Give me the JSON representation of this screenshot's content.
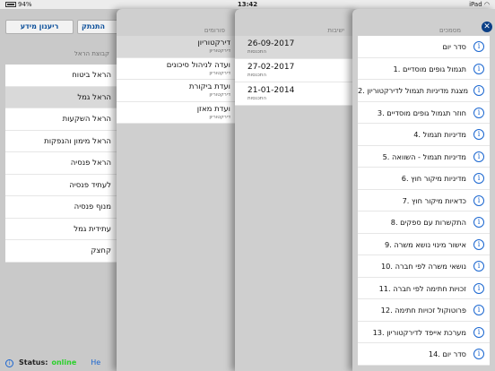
{
  "status_bar": {
    "battery": "94%",
    "time": "13:42",
    "device": "iPad"
  },
  "toolbar": {
    "info_button": "ריענון מידע",
    "logout_button": "התנתק"
  },
  "groups": {
    "header": "קבוצת הראל",
    "items": [
      {
        "label": "הראל ביטוח"
      },
      {
        "label": "הראל גמל"
      },
      {
        "label": "הראל השקעות"
      },
      {
        "label": "הראל מימון והנפקות"
      },
      {
        "label": "הראל פנסיה"
      },
      {
        "label": "לעתיד פנסיה"
      },
      {
        "label": "מנוף פנסיה"
      },
      {
        "label": "עתידית גמל"
      },
      {
        "label": "קחצק"
      }
    ]
  },
  "footer": {
    "status_label": "Status:",
    "status_value": "online",
    "lang": "He"
  },
  "forums": {
    "header": "פורומים",
    "items": [
      {
        "title": "דירקטוריון",
        "sub": "דירקטוריון"
      },
      {
        "title": "ועדה לניהול סיכונים",
        "sub": "דירקטוריון"
      },
      {
        "title": "ועדת ביקורת",
        "sub": "דירקטוריון"
      },
      {
        "title": "ועדת מאזן",
        "sub": "דירקטוריון"
      }
    ]
  },
  "meetings": {
    "header": "ישיבות",
    "items": [
      {
        "date": "26-09-2017",
        "sub": "התכנסות"
      },
      {
        "date": "27-02-2017",
        "sub": "התכנסות"
      },
      {
        "date": "21-01-2014",
        "sub": "התכנסות"
      }
    ]
  },
  "documents": {
    "header": "מסמכים",
    "close_label": "✕",
    "items": [
      {
        "label": "סדר יום"
      },
      {
        "label": "1. תגמול גופים מוסדיים"
      },
      {
        "label": "2. מצגת מדיניות תגמול לדירקטוריון"
      },
      {
        "label": "3. חוזר תגמול גופים מוסדיים"
      },
      {
        "label": "4. מדיניות תגמול"
      },
      {
        "label": "5. מדיניות תגמול - השוואה"
      },
      {
        "label": "6. מדיניות מיקור חוץ"
      },
      {
        "label": "7. כדאיות מיקור חוץ"
      },
      {
        "label": "8. התקשרות עם ספקים"
      },
      {
        "label": "9. אישור מינוי נושא משרה"
      },
      {
        "label": "10. נושאי משרה לפי חברה"
      },
      {
        "label": "11. זכויות חתימה לפי חברה"
      },
      {
        "label": "12. פרוטוקול זכויות חתימה"
      },
      {
        "label": "13. מערכת אייפד לדירקטוריון"
      },
      {
        "label": "14. סדר יום"
      }
    ]
  }
}
